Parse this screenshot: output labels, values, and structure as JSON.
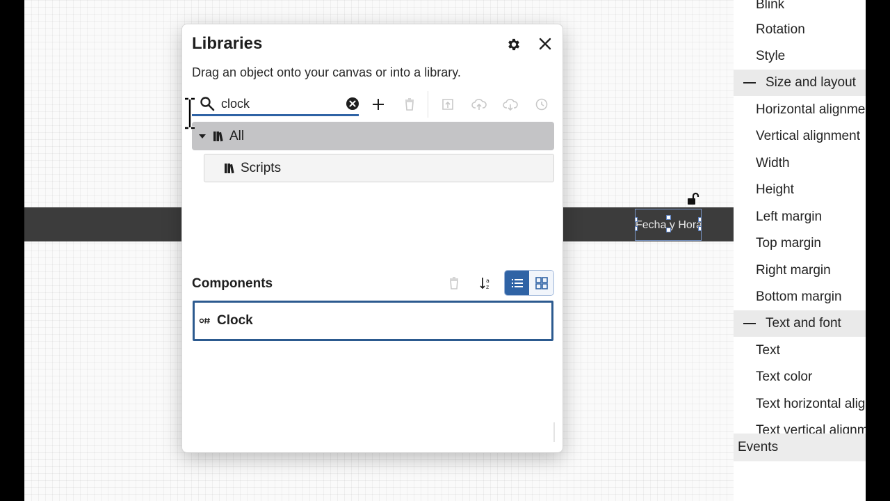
{
  "canvas": {
    "widget_text": "Fecha y Hora"
  },
  "properties": {
    "items_top": [
      "Blink",
      "Rotation",
      "Style"
    ],
    "section_size": "Size and layout",
    "items_size": [
      "Horizontal alignment",
      "Vertical alignment",
      "Width",
      "Height",
      "Left margin",
      "Top margin",
      "Right margin",
      "Bottom margin"
    ],
    "section_text": "Text and font",
    "items_text": [
      "Text",
      "Text color",
      "Text horizontal alignment",
      "Text vertical alignment"
    ],
    "events_label": "Events"
  },
  "dialog": {
    "title": "Libraries",
    "subtitle": "Drag an object onto your canvas or into a library.",
    "search": {
      "value": "clock",
      "placeholder": ""
    },
    "tree": {
      "root_label": "All",
      "child_label": "Scripts"
    },
    "components": {
      "title": "Components",
      "items": [
        "Clock"
      ]
    }
  },
  "icons": {
    "settings": "gear-icon",
    "close": "close-icon",
    "search": "search-icon",
    "clear": "clear-circle-icon",
    "add": "plus-icon",
    "delete": "trash-icon",
    "move": "move-to-library-icon",
    "upload": "cloud-upload-icon",
    "download": "cloud-download-icon",
    "history": "history-icon",
    "sort": "sort-icon",
    "list_view": "list-view-icon",
    "grid_view": "grid-view-icon",
    "library": "library-icon",
    "component": "component-icon",
    "lock": "lock-open-icon"
  },
  "colors": {
    "accent": "#2f63a5",
    "selected_tree": "#c4c4c6",
    "dark_bar": "#3c3c3c"
  }
}
